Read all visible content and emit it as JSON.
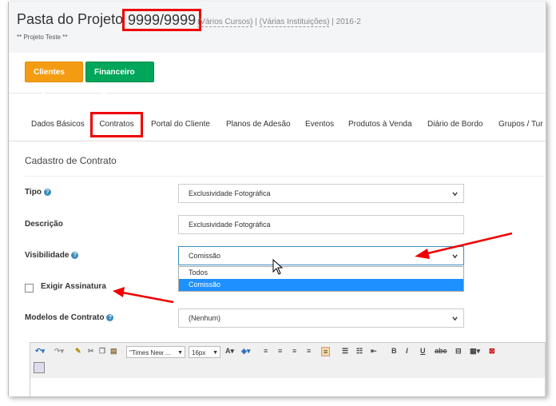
{
  "header": {
    "title": "Pasta do Projeto",
    "project_id": "9999/9999",
    "courses": "(Vários Cursos)",
    "separator": "|",
    "institutions": "(Várias Instituições)",
    "year": "2016-2",
    "subtitle": "** Projeto Teste **"
  },
  "toolbar": {
    "clientes_label": "Clientes",
    "financeiro_label": "Financeiro"
  },
  "tabs": [
    {
      "label": "Dados Básicos"
    },
    {
      "label": "Contratos"
    },
    {
      "label": "Portal do Cliente"
    },
    {
      "label": "Planos de Adesão"
    },
    {
      "label": "Eventos"
    },
    {
      "label": "Produtos à Venda"
    },
    {
      "label": "Diário de Bordo"
    },
    {
      "label": "Grupos / Tur"
    }
  ],
  "form": {
    "section_title": "Cadastro de Contrato",
    "tipo": {
      "label": "Tipo",
      "value": "Exclusividade Fotográfica"
    },
    "descricao": {
      "label": "Descrição",
      "value": "Exclusividade Fotográfica"
    },
    "visibilidade": {
      "label": "Visibilidade",
      "value": "Comissão",
      "options": [
        "Todos",
        "Comissão"
      ]
    },
    "exigir_assinatura": {
      "label": "Exigir Assinatura",
      "checked": false
    },
    "modelos": {
      "label": "Modelos de Contrato",
      "value": "(Nenhum)"
    }
  },
  "editor": {
    "font_family": "\"Times New ...",
    "font_size": "16px"
  },
  "colors": {
    "clientes": "#f39c12",
    "financeiro": "#00a65a",
    "highlight": "#ee0000",
    "selected_option": "#1e90ff",
    "help_icon": "#3c8dbc"
  }
}
